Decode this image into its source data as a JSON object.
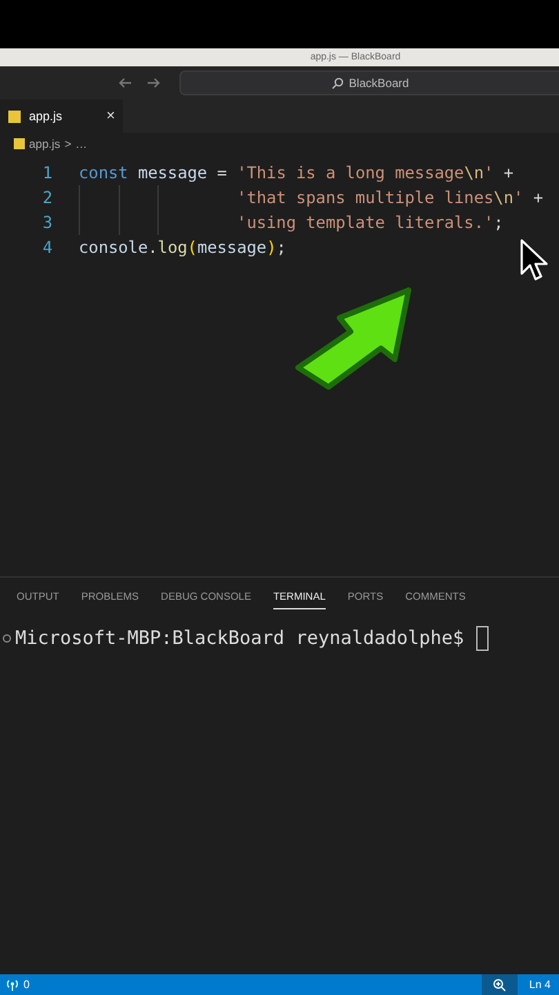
{
  "window": {
    "title": "app.js — BlackBoard"
  },
  "command_center": {
    "label": "BlackBoard"
  },
  "tabs": [
    {
      "label": "app.js",
      "selected": true,
      "close": "×"
    }
  ],
  "breadcrumb": {
    "file": "app.js",
    "separator": ">",
    "rest": "…"
  },
  "code": [
    {
      "number": "1",
      "indented": false,
      "tokens": [
        {
          "text": "const",
          "kind": "keyword"
        },
        {
          "text": " message ",
          "kind": "variable"
        },
        {
          "text": "= ",
          "kind": "plain"
        },
        {
          "text": "'This is a long message",
          "kind": "string"
        },
        {
          "text": "\\n",
          "kind": "escape"
        },
        {
          "text": "'",
          "kind": "string"
        },
        {
          "text": " +",
          "kind": "plain"
        }
      ]
    },
    {
      "number": "2",
      "indented": true,
      "tokens": [
        {
          "text": "'that spans multiple lines",
          "kind": "string"
        },
        {
          "text": "\\n",
          "kind": "escape"
        },
        {
          "text": "'",
          "kind": "string"
        },
        {
          "text": " +",
          "kind": "plain"
        }
      ]
    },
    {
      "number": "3",
      "indented": true,
      "tokens": [
        {
          "text": "'using template literals.'",
          "kind": "string"
        },
        {
          "text": ";",
          "kind": "plain"
        }
      ]
    },
    {
      "number": "4",
      "indented": false,
      "tokens": [
        {
          "text": "console",
          "kind": "variable"
        },
        {
          "text": ".",
          "kind": "plain"
        },
        {
          "text": "log",
          "kind": "function"
        },
        {
          "text": "(",
          "kind": "paren"
        },
        {
          "text": "message",
          "kind": "variable"
        },
        {
          "text": ")",
          "kind": "paren"
        },
        {
          "text": ";",
          "kind": "plain"
        }
      ]
    }
  ],
  "panel_tabs": [
    {
      "label": "OUTPUT",
      "selected": false
    },
    {
      "label": "PROBLEMS",
      "selected": false
    },
    {
      "label": "DEBUG CONSOLE",
      "selected": false
    },
    {
      "label": "TERMINAL",
      "selected": true
    },
    {
      "label": "PORTS",
      "selected": false
    },
    {
      "label": "COMMENTS",
      "selected": false
    }
  ],
  "terminal": {
    "prompt": "Microsoft-MBP:BlackBoard reynaldadolphe$"
  },
  "status_bar": {
    "ports": "0",
    "position": "Ln 4"
  }
}
